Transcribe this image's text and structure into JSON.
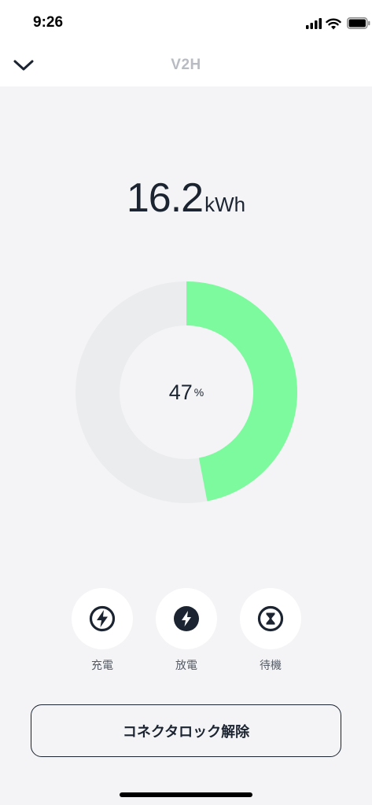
{
  "status_bar": {
    "time": "9:26"
  },
  "nav": {
    "title": "V2H"
  },
  "energy": {
    "value": "16.2",
    "unit": "kWh"
  },
  "battery": {
    "percent_value": "47",
    "percent_unit": "%",
    "fill_fraction": 0.47,
    "fill_color": "#7dfa9d",
    "track_color": "#ebecee"
  },
  "modes": [
    {
      "label": "充電",
      "icon": "bolt-outline-icon"
    },
    {
      "label": "放電",
      "icon": "bolt-filled-icon"
    },
    {
      "label": "待機",
      "icon": "hourglass-icon"
    }
  ],
  "actions": {
    "unlock_label": "コネクタロック解除"
  }
}
